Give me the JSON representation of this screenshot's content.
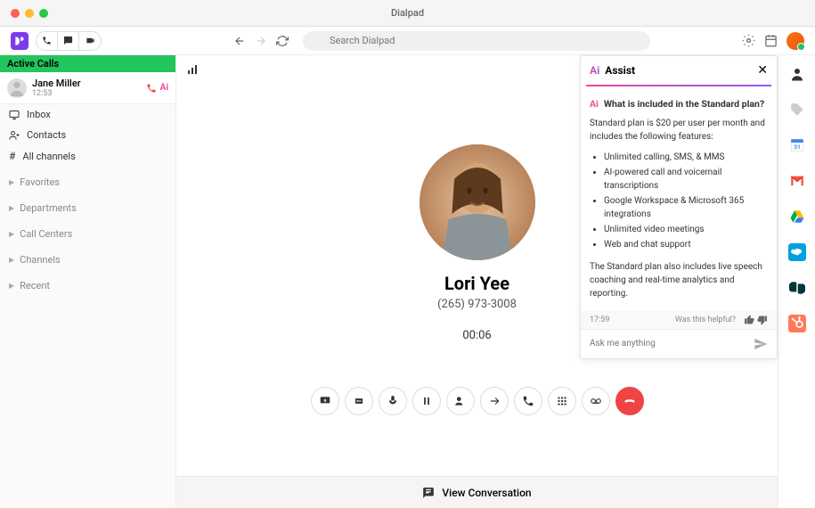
{
  "window": {
    "title": "Dialpad"
  },
  "topbar": {
    "search_placeholder": "Search Dialpad"
  },
  "sidebar": {
    "active_calls_label": "Active Calls",
    "call": {
      "name": "Jane Miller",
      "time": "12:53"
    },
    "nav": {
      "inbox": "Inbox",
      "contacts": "Contacts",
      "all_channels": "All channels"
    },
    "sections": {
      "favorites": "Favorites",
      "departments": "Departments",
      "call_centers": "Call Centers",
      "channels": "Channels",
      "recent": "Recent"
    }
  },
  "caller": {
    "name": "Lori Yee",
    "phone": "(265) 973-3008",
    "timer": "00:06"
  },
  "view_conversation": "View Conversation",
  "assist": {
    "title": "Assist",
    "question": "What is included in the Standard plan?",
    "description": "Standard plan is $20 per user per month and includes the following features:",
    "features": [
      "Unlimited calling, SMS, & MMS",
      "AI-powered call and voicemail transcriptions",
      "Google Workspace & Microsoft 365 integrations",
      "Unlimited video meetings",
      "Web and chat support"
    ],
    "extra": "The Standard plan also includes live speech coaching and real-time analytics and reporting.",
    "timestamp": "17:59",
    "helpful_label": "Was this helpful?",
    "input_placeholder": "Ask me anything"
  }
}
